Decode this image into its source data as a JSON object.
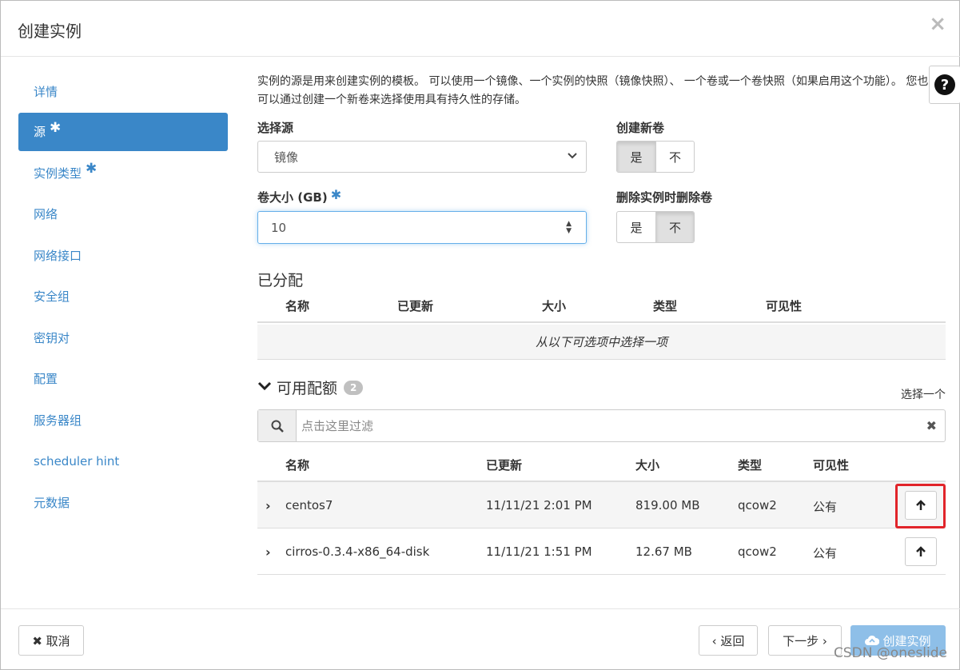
{
  "dialog": {
    "title": "创建实例",
    "close": "×"
  },
  "sidebar": {
    "items": [
      {
        "label": "详情",
        "required": false,
        "active": false
      },
      {
        "label": "源",
        "required": true,
        "active": true
      },
      {
        "label": "实例类型",
        "required": true,
        "active": false
      },
      {
        "label": "网络",
        "required": false,
        "active": false
      },
      {
        "label": "网络接口",
        "required": false,
        "active": false
      },
      {
        "label": "安全组",
        "required": false,
        "active": false
      },
      {
        "label": "密钥对",
        "required": false,
        "active": false
      },
      {
        "label": "配置",
        "required": false,
        "active": false
      },
      {
        "label": "服务器组",
        "required": false,
        "active": false
      },
      {
        "label": "scheduler hint",
        "required": false,
        "active": false
      },
      {
        "label": "元数据",
        "required": false,
        "active": false
      }
    ],
    "required_mark": "✱"
  },
  "source": {
    "help_text": "实例的源是用来创建实例的模板。 可以使用一个镜像、一个实例的快照（镜像快照）、 一个卷或一个卷快照（如果启用这个功能）。 您也可以通过创建一个新卷来选择使用具有持久性的存储。",
    "help_icon": "?",
    "select_source_label": "选择源",
    "select_source_value": "镜像",
    "create_volume_label": "创建新卷",
    "create_volume_yes": "是",
    "create_volume_no": "不",
    "volume_size_label": "卷大小 (GB)",
    "volume_size_value": "10",
    "delete_volume_label": "删除实例时删除卷",
    "delete_volume_yes": "是",
    "delete_volume_no": "不"
  },
  "allocated": {
    "title": "已分配",
    "columns": [
      "名称",
      "已更新",
      "大小",
      "类型",
      "可见性"
    ],
    "empty_text": "从以下可选项中选择一项"
  },
  "available": {
    "title": "可用配额",
    "count": "2",
    "select_one": "选择一个",
    "filter_placeholder": "点击这里过滤",
    "columns": [
      "名称",
      "已更新",
      "大小",
      "类型",
      "可见性"
    ],
    "rows": [
      {
        "name": "centos7",
        "updated": "11/11/21 2:01 PM",
        "size": "819.00 MB",
        "type": "qcow2",
        "visibility": "公有"
      },
      {
        "name": "cirros-0.3.4-x86_64-disk",
        "updated": "11/11/21 1:51 PM",
        "size": "12.67 MB",
        "type": "qcow2",
        "visibility": "公有"
      }
    ]
  },
  "footer": {
    "cancel": "✖ 取消",
    "back": "‹ 返回",
    "next": "下一步 ›",
    "create": "创建实例"
  },
  "watermark": "CSDN @oneslide",
  "colors": {
    "accent": "#3a87c8",
    "highlight": "#e1242a"
  }
}
